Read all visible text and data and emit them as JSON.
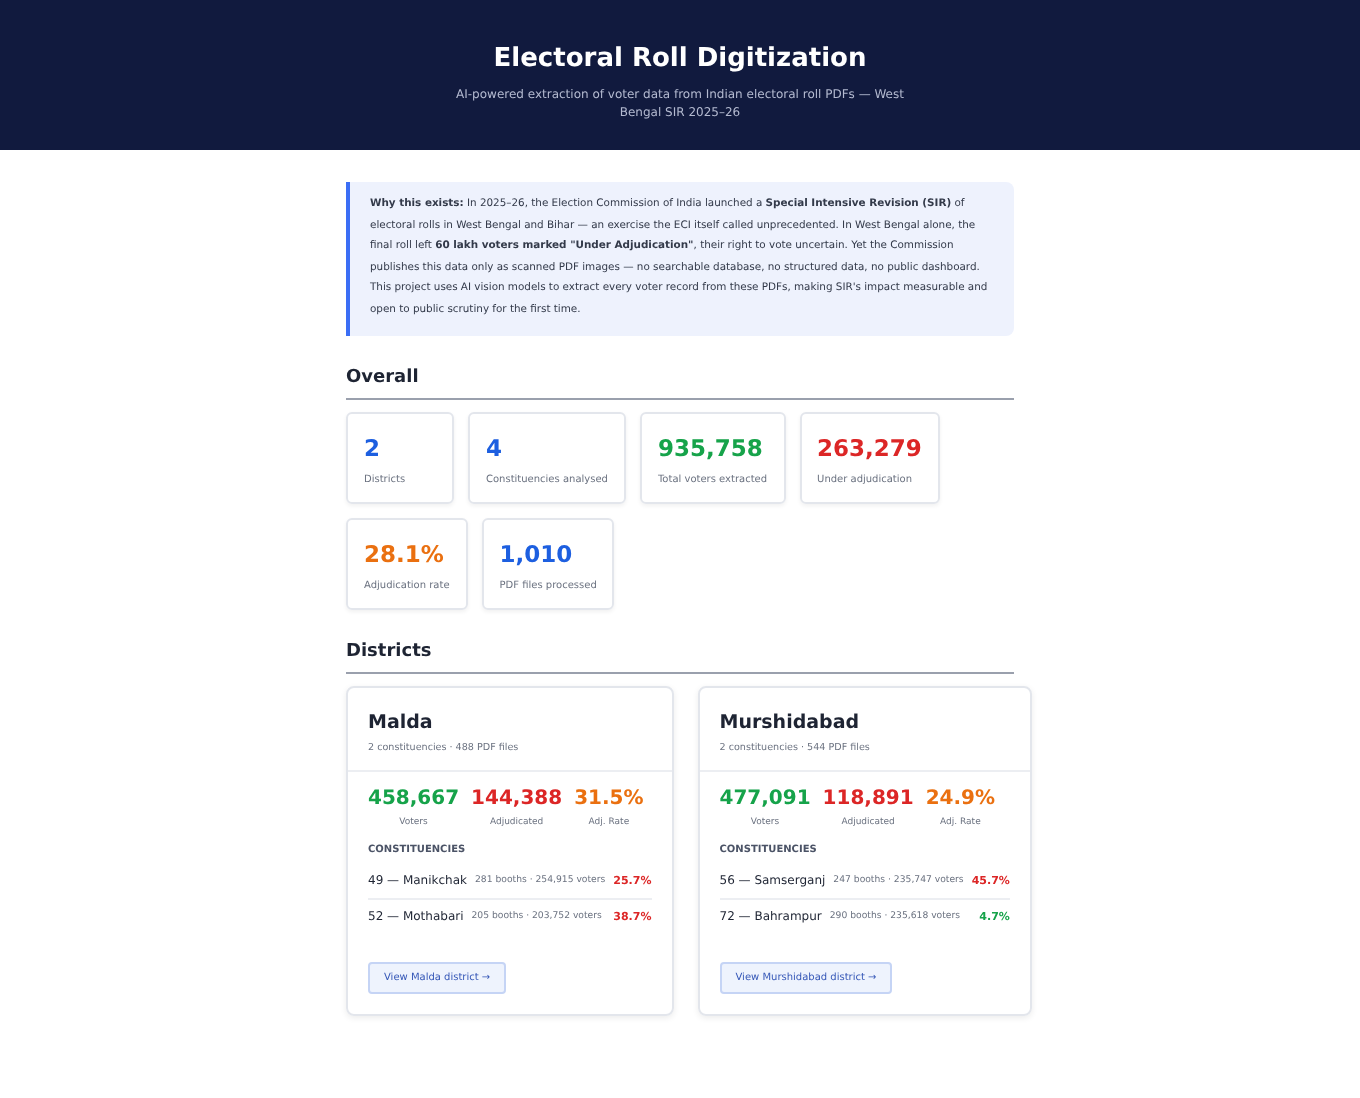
{
  "header": {
    "title": "Electoral Roll Digitization",
    "subtitle": "AI-powered extraction of voter data from Indian electoral roll PDFs — West Bengal SIR 2025–26"
  },
  "intro": "**Why this exists:** In 2025–26, the Election Commission of India launched a **Special Intensive Revision (SIR)** of electoral rolls in West Bengal and Bihar — an exercise the ECI itself called unprecedented. In West Bengal alone, the final roll left **60 lakh voters marked \"Under Adjudication\"**, their right to vote uncertain. Yet the Commission publishes this data only as scanned PDF images — no searchable database, no structured data, no public dashboard. This project uses AI vision models to extract every voter record from these PDFs, making SIR's impact measurable and open to public scrutiny for the first time.",
  "overall": {
    "heading": "Overall",
    "stats": [
      {
        "value": "2",
        "label": "Districts",
        "color": "#1d5fe0"
      },
      {
        "value": "4",
        "label": "Constituencies analysed",
        "color": "#1d5fe0"
      },
      {
        "value": "935,758",
        "label": "Total voters extracted",
        "color": "#16a34a"
      },
      {
        "value": "263,279",
        "label": "Under adjudication",
        "color": "#dc2626"
      },
      {
        "value": "28.1%",
        "label": "Adjudication rate",
        "color": "#ea7010"
      },
      {
        "value": "1,010",
        "label": "PDF files processed",
        "color": "#1d5fe0"
      }
    ]
  },
  "districts": {
    "heading": "Districts",
    "cards": [
      {
        "name": "Malda",
        "meta": "2 constituencies · 488 PDF files",
        "metrics": [
          {
            "value": "458,667",
            "label": "Voters",
            "color": "#16a34a"
          },
          {
            "value": "144,388",
            "label": "Adjudicated",
            "color": "#dc2626"
          },
          {
            "value": "31.5%",
            "label": "Adj. Rate",
            "color": "#ea7010"
          }
        ],
        "section": "CONSTITUENCIES",
        "constituencies": [
          {
            "name": "49 — Manikchak",
            "detail": "281 booths · 254,915 voters",
            "rate": "25.7%",
            "color": "#dc2626"
          },
          {
            "name": "52 — Mothabari",
            "detail": "205 booths · 203,752 voters",
            "rate": "38.7%",
            "color": "#dc2626"
          }
        ],
        "link": "View Malda district →"
      },
      {
        "name": "Murshidabad",
        "meta": "2 constituencies · 544 PDF files",
        "metrics": [
          {
            "value": "477,091",
            "label": "Voters",
            "color": "#16a34a"
          },
          {
            "value": "118,891",
            "label": "Adjudicated",
            "color": "#dc2626"
          },
          {
            "value": "24.9%",
            "label": "Adj. Rate",
            "color": "#ea7010"
          }
        ],
        "section": "CONSTITUENCIES",
        "constituencies": [
          {
            "name": "56 — Samserganj",
            "detail": "247 booths · 235,747 voters",
            "rate": "45.7%",
            "color": "#dc2626"
          },
          {
            "name": "72 — Bahrampur",
            "detail": "290 booths · 235,618 voters",
            "rate": "4.7%",
            "color": "#16a34a"
          }
        ],
        "link": "View Murshidabad district →"
      }
    ]
  }
}
